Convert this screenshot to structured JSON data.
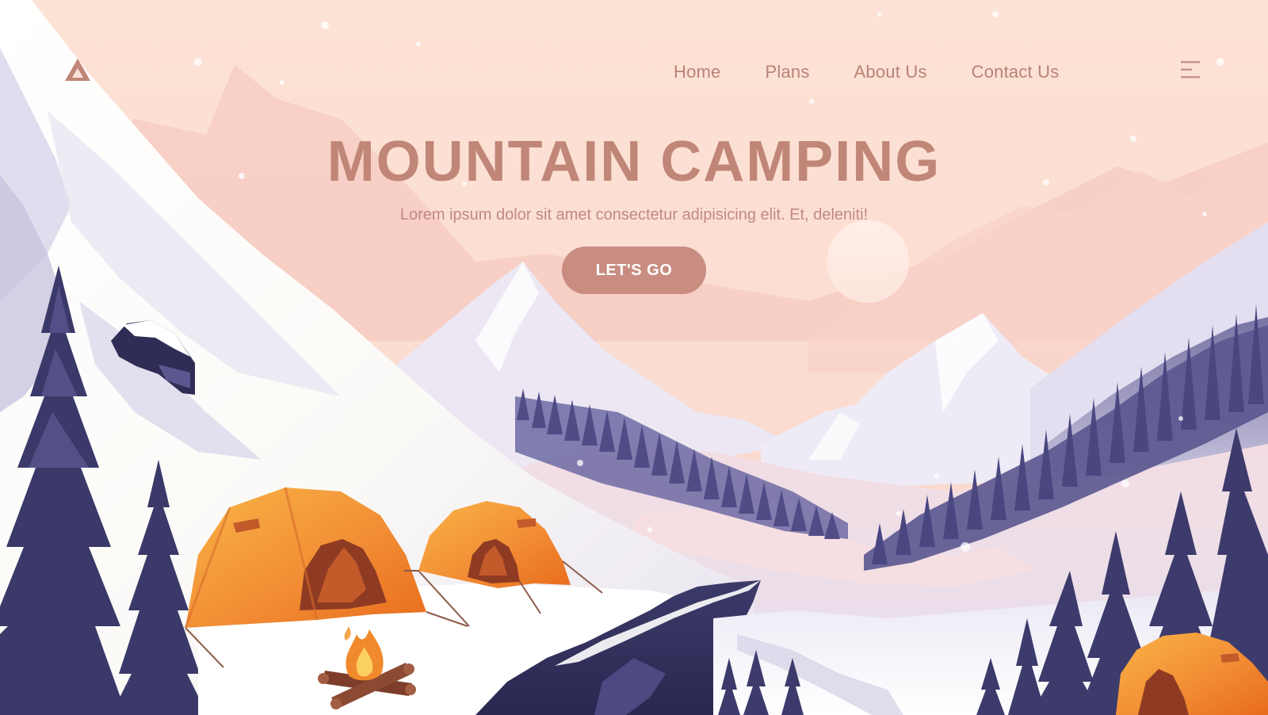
{
  "brand": {
    "logo_icon": "triangle-logo-icon"
  },
  "nav": {
    "items": [
      {
        "label": "Home"
      },
      {
        "label": "Plans"
      },
      {
        "label": "About Us"
      },
      {
        "label": "Contact Us"
      }
    ],
    "menu_icon": "hamburger-menu-icon"
  },
  "hero": {
    "title": "MOUNTAIN CAMPING",
    "subtitle": "Lorem ipsum dolor sit amet consectetur adipisicing elit. Et, deleniti!",
    "cta_label": "LET'S GO"
  },
  "colors": {
    "sky": "#fbe2d8",
    "accent": "#c08677",
    "button": "#c88c80",
    "tent_orange": "#f08a2d",
    "tree_navy": "#3c3a69"
  }
}
